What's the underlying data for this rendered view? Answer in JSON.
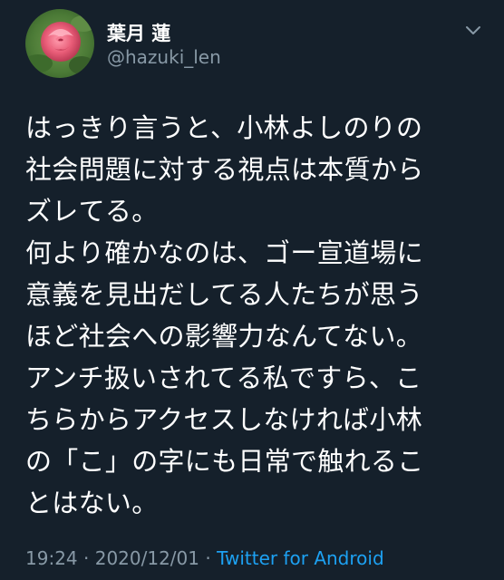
{
  "user": {
    "display_name": "葉月 蓮",
    "handle": "@hazuki_len",
    "avatar_icon": "rose-avatar"
  },
  "tweet": {
    "lines": [
      "はっきり言うと、小林よしのりの",
      "社会問題に対する視点は本質から",
      "ズレてる。",
      "何より確かなのは、ゴー宣道場に",
      "意義を見出だしてる人たちが思う",
      "ほど社会への影響力なんてない。",
      "アンチ扱いされてる私ですら、こ",
      "ちらからアクセスしなければ小林",
      "の「こ」の字にも日常で触れるこ",
      "とはない。"
    ]
  },
  "meta": {
    "time": "19:24",
    "separator1": " · ",
    "date": "2020/12/01",
    "separator2": " · ",
    "source": "Twitter for Android"
  },
  "menu": {
    "caret_icon": "chevron-down-icon"
  },
  "colors": {
    "background": "#15202b",
    "text": "#ffffff",
    "secondary": "#8899a6",
    "link": "#1da1f2"
  }
}
